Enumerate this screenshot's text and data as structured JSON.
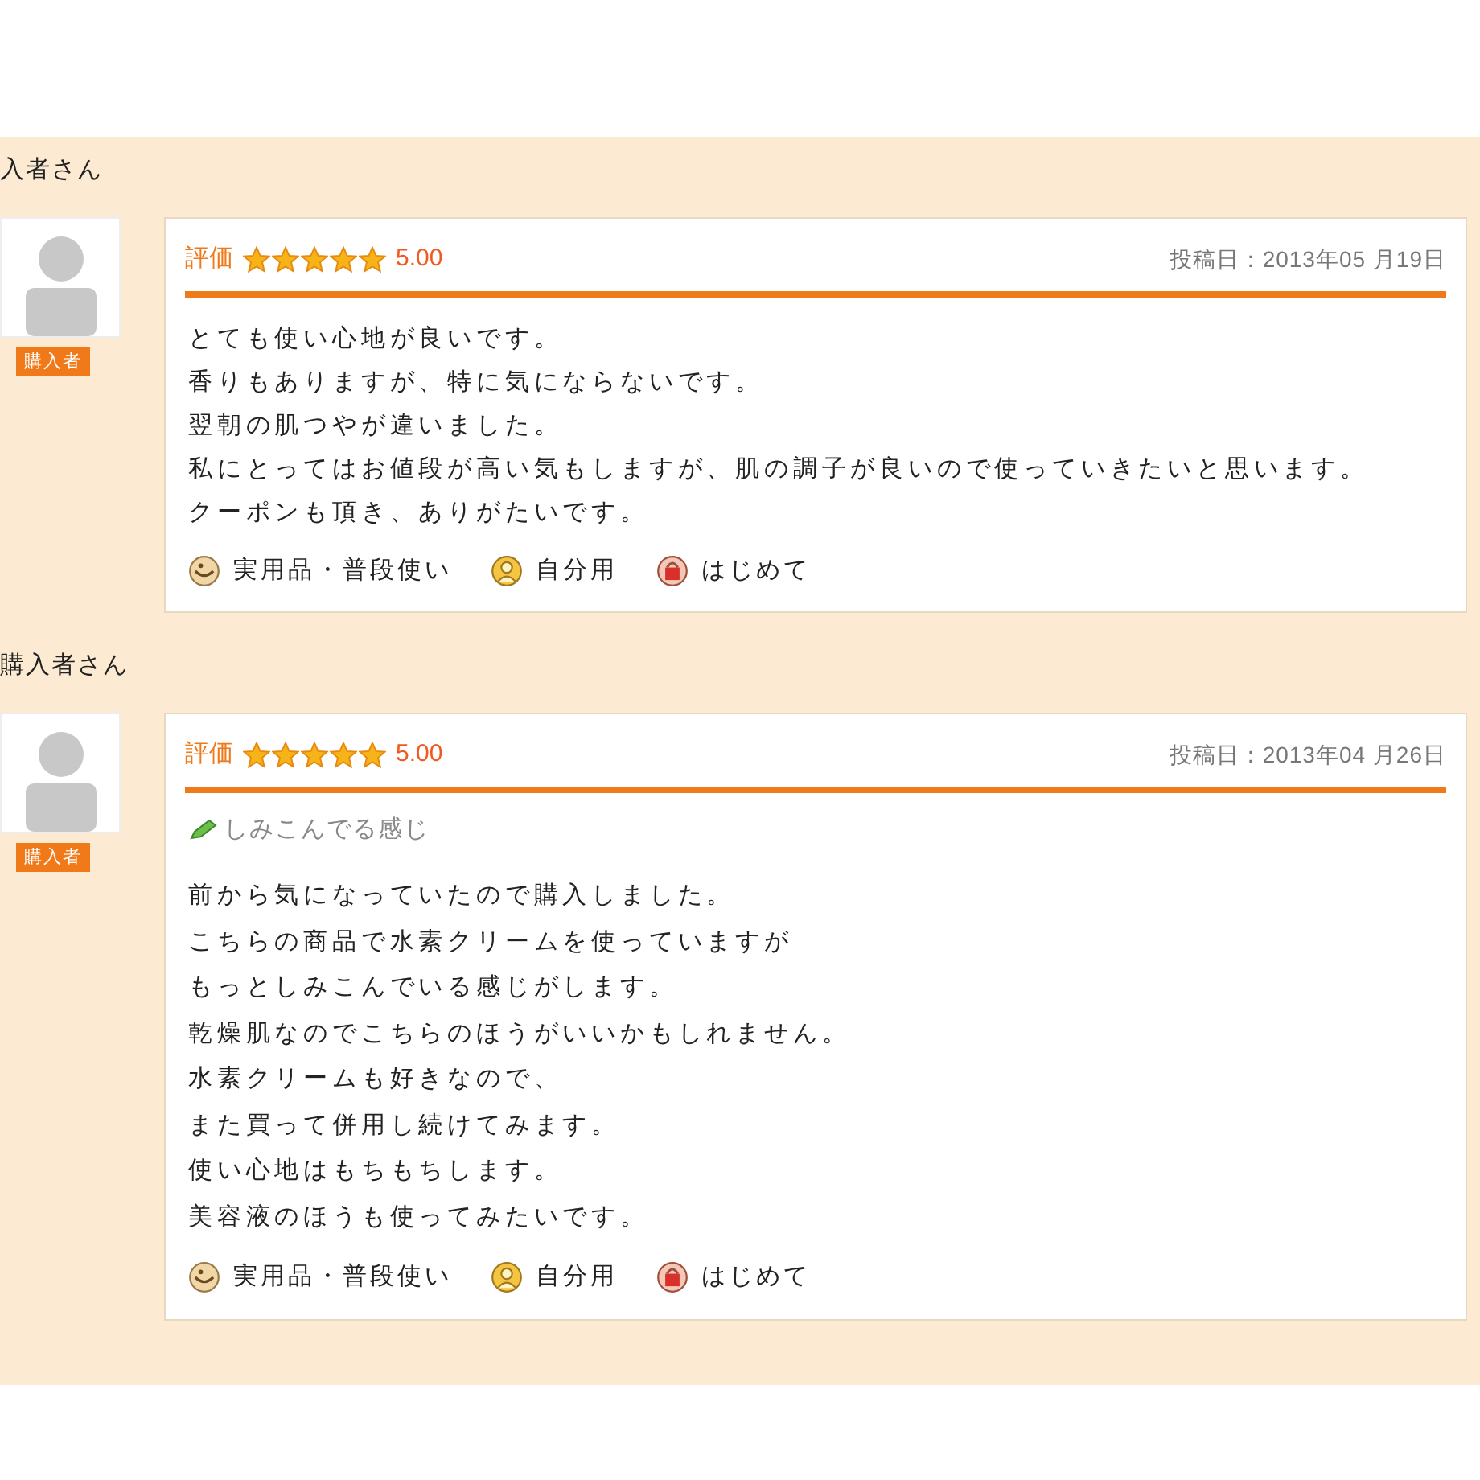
{
  "reviews": [
    {
      "reviewer": "入者さん",
      "badge": "購入者",
      "rating_label": "評価",
      "stars": 5,
      "score": "5.00",
      "date": "投稿日：2013年05 月19日",
      "lines": [
        "とても使い心地が良いです。",
        "香りもありますが、特に気にならないです。",
        "翌朝の肌つやが違いました。",
        "私にとってはお値段が高い気もしますが、肌の調子が良いので使っていきたいと思います。",
        "クーポンも頂き、ありがたいです。"
      ],
      "tags": [
        {
          "kind": "usage",
          "label": "実用品・普段使い"
        },
        {
          "kind": "recipient",
          "label": "自分用"
        },
        {
          "kind": "frequency",
          "label": "はじめて"
        }
      ]
    },
    {
      "reviewer": "購入者さん",
      "badge": "購入者",
      "rating_label": "評価",
      "stars": 5,
      "score": "5.00",
      "date": "投稿日：2013年04 月26日",
      "title": "しみこんでる感じ",
      "lines": [
        "前から気になっていたので購入しました。",
        "こちらの商品で水素クリームを使っていますが",
        "もっとしみこんでいる感じがします。",
        "乾燥肌なのでこちらのほうがいいかもしれません。",
        "水素クリームも好きなので、",
        "また買って併用し続けてみます。",
        "使い心地はもちもちします。",
        "美容液のほうも使ってみたいです。"
      ],
      "tags": [
        {
          "kind": "usage",
          "label": "実用品・普段使い"
        },
        {
          "kind": "recipient",
          "label": "自分用"
        },
        {
          "kind": "frequency",
          "label": "はじめて"
        }
      ]
    }
  ]
}
